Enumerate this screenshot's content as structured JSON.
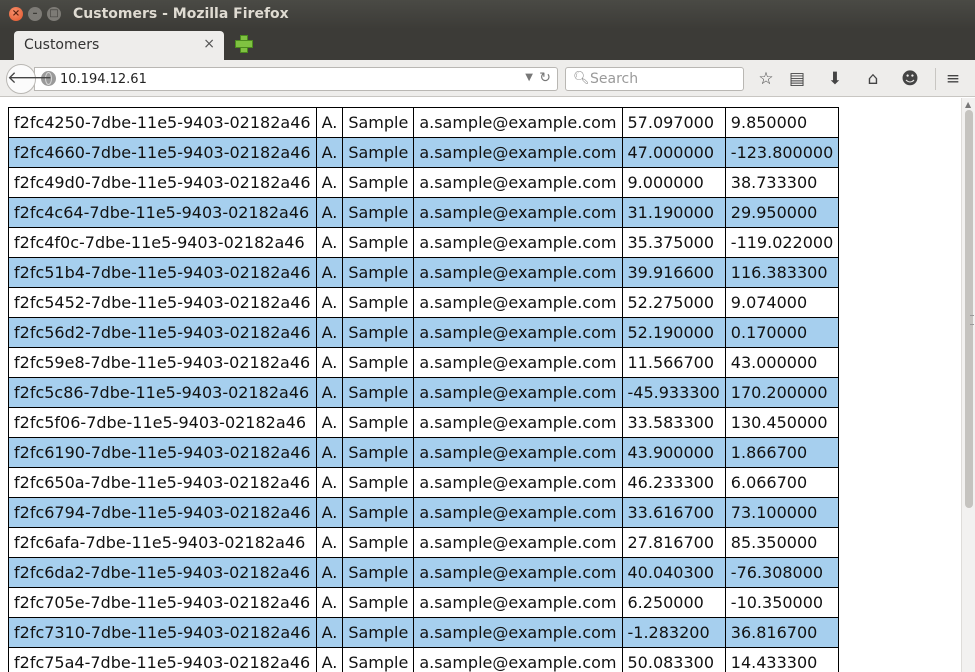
{
  "window": {
    "title": "Customers - Mozilla Firefox"
  },
  "tab": {
    "label": "Customers",
    "close": "×"
  },
  "nav": {
    "url": "10.194.12.61",
    "search_placeholder": "Search"
  },
  "table": {
    "rows": [
      [
        "f2fc4250-7dbe-11e5-9403-02182a46",
        "A.",
        "Sample",
        "a.sample@example.com",
        "57.097000",
        "9.850000"
      ],
      [
        "f2fc4660-7dbe-11e5-9403-02182a46",
        "A.",
        "Sample",
        "a.sample@example.com",
        "47.000000",
        "-123.800000"
      ],
      [
        "f2fc49d0-7dbe-11e5-9403-02182a46",
        "A.",
        "Sample",
        "a.sample@example.com",
        "9.000000",
        "38.733300"
      ],
      [
        "f2fc4c64-7dbe-11e5-9403-02182a46",
        "A.",
        "Sample",
        "a.sample@example.com",
        "31.190000",
        "29.950000"
      ],
      [
        "f2fc4f0c-7dbe-11e5-9403-02182a46",
        "A.",
        "Sample",
        "a.sample@example.com",
        "35.375000",
        "-119.022000"
      ],
      [
        "f2fc51b4-7dbe-11e5-9403-02182a46",
        "A.",
        "Sample",
        "a.sample@example.com",
        "39.916600",
        "116.383300"
      ],
      [
        "f2fc5452-7dbe-11e5-9403-02182a46",
        "A.",
        "Sample",
        "a.sample@example.com",
        "52.275000",
        "9.074000"
      ],
      [
        "f2fc56d2-7dbe-11e5-9403-02182a46",
        "A.",
        "Sample",
        "a.sample@example.com",
        "52.190000",
        "0.170000"
      ],
      [
        "f2fc59e8-7dbe-11e5-9403-02182a46",
        "A.",
        "Sample",
        "a.sample@example.com",
        "11.566700",
        "43.000000"
      ],
      [
        "f2fc5c86-7dbe-11e5-9403-02182a46",
        "A.",
        "Sample",
        "a.sample@example.com",
        "-45.933300",
        "170.200000"
      ],
      [
        "f2fc5f06-7dbe-11e5-9403-02182a46",
        "A.",
        "Sample",
        "a.sample@example.com",
        "33.583300",
        "130.450000"
      ],
      [
        "f2fc6190-7dbe-11e5-9403-02182a46",
        "A.",
        "Sample",
        "a.sample@example.com",
        "43.900000",
        "1.866700"
      ],
      [
        "f2fc650a-7dbe-11e5-9403-02182a46",
        "A.",
        "Sample",
        "a.sample@example.com",
        "46.233300",
        "6.066700"
      ],
      [
        "f2fc6794-7dbe-11e5-9403-02182a46",
        "A.",
        "Sample",
        "a.sample@example.com",
        "33.616700",
        "73.100000"
      ],
      [
        "f2fc6afa-7dbe-11e5-9403-02182a46",
        "A.",
        "Sample",
        "a.sample@example.com",
        "27.816700",
        "85.350000"
      ],
      [
        "f2fc6da2-7dbe-11e5-9403-02182a46",
        "A.",
        "Sample",
        "a.sample@example.com",
        "40.040300",
        "-76.308000"
      ],
      [
        "f2fc705e-7dbe-11e5-9403-02182a46",
        "A.",
        "Sample",
        "a.sample@example.com",
        "6.250000",
        "-10.350000"
      ],
      [
        "f2fc7310-7dbe-11e5-9403-02182a46",
        "A.",
        "Sample",
        "a.sample@example.com",
        "-1.283200",
        "36.816700"
      ],
      [
        "f2fc75a4-7dbe-11e5-9403-02182a46",
        "A.",
        "Sample",
        "a.sample@example.com",
        "50.083300",
        "14.433300"
      ]
    ]
  }
}
